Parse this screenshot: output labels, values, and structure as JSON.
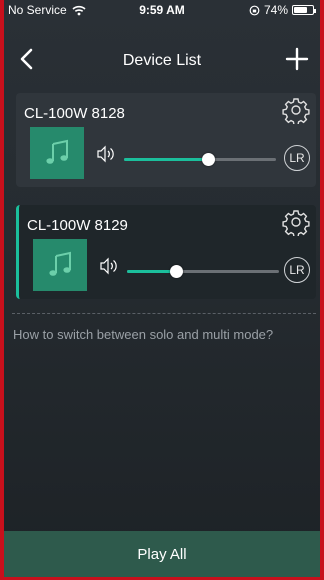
{
  "status_bar": {
    "carrier": "No Service",
    "time": "9:59 AM",
    "battery_text": "74%",
    "battery_level": 0.74
  },
  "nav": {
    "title": "Device List",
    "back_icon": "chevron-left-icon",
    "add_icon": "plus-icon"
  },
  "devices": [
    {
      "name": "CL-100W 8128",
      "volume": 0.55,
      "channel": "LR",
      "selected": false
    },
    {
      "name": "CL-100W 8129",
      "volume": 0.32,
      "channel": "LR",
      "selected": true
    }
  ],
  "help_link": "How to switch between solo and multi mode?",
  "play_all_label": "Play All",
  "colors": {
    "accent": "#1bbf9c",
    "background": "#262c31",
    "card": "#30363c",
    "selected_card": "#1f262a",
    "play_all_bar": "#2e5a4c",
    "art_tile": "#268a6c",
    "frame_border": "#c8101c"
  }
}
